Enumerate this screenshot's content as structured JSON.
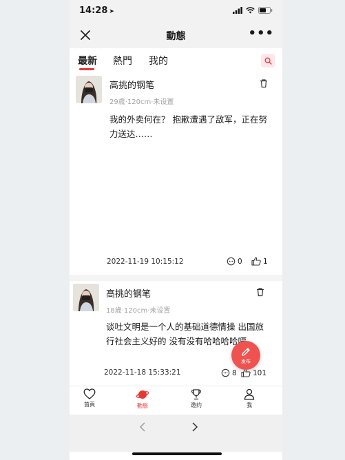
{
  "status": {
    "time": "14:28"
  },
  "navbar": {
    "title": "動態"
  },
  "tabs": [
    {
      "label": "最新",
      "active": true
    },
    {
      "label": "熱門",
      "active": false
    },
    {
      "label": "我的",
      "active": false
    }
  ],
  "posts": [
    {
      "username": "高挑的钢笔",
      "meta": "29歲·120cm·未设置",
      "content": "我的外卖何在？ 抱歉遭遇了敌军，正在努力送达……",
      "timestamp": "2022-11-19 10:15:12",
      "comments": "0",
      "likes": "1"
    },
    {
      "username": "高挑的钢笔",
      "meta": "18歲·120cm·未设置",
      "content": "谈吐文明是一个人的基础道德情操  出国旅行社会主义好的  没有没有哈哈哈哈嗝",
      "timestamp": "2022-11-18 15:33:21",
      "comments": "8",
      "likes": "101"
    }
  ],
  "fab": {
    "label": "发布"
  },
  "bottom_nav": [
    {
      "label": "首頁",
      "icon": "heart-icon"
    },
    {
      "label": "動態",
      "icon": "planet-icon",
      "active": true
    },
    {
      "label": "邀约",
      "icon": "trophy-icon"
    },
    {
      "label": "我",
      "icon": "person-icon"
    }
  ],
  "colors": {
    "accent": "#e53935",
    "fab": "#ef5350",
    "muted": "#a3a3a3"
  }
}
